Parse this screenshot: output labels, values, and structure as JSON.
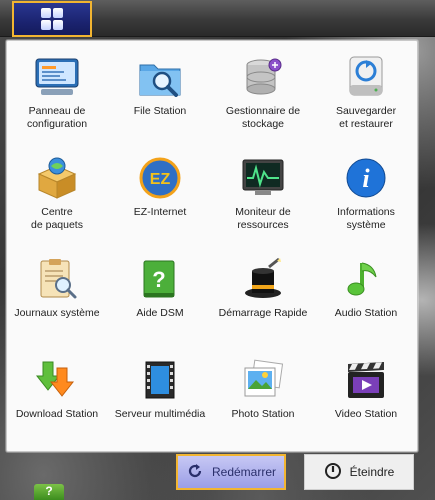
{
  "taskbar": {
    "main_menu_icon": "grid-icon"
  },
  "apps": [
    {
      "id": "control-panel",
      "label": "Panneau de\nconfiguration",
      "icon": "control-panel-icon"
    },
    {
      "id": "file-station",
      "label": "File Station",
      "icon": "file-station-icon"
    },
    {
      "id": "storage-manager",
      "label": "Gestionnaire de\nstockage",
      "icon": "storage-manager-icon"
    },
    {
      "id": "backup-restore",
      "label": "Sauvegarder\net restaurer",
      "icon": "backup-icon"
    },
    {
      "id": "package-center",
      "label": "Centre\nde paquets",
      "icon": "package-center-icon"
    },
    {
      "id": "ez-internet",
      "label": "EZ-Internet",
      "icon": "ez-internet-icon"
    },
    {
      "id": "resource-monitor",
      "label": "Moniteur de\nressources",
      "icon": "resource-monitor-icon"
    },
    {
      "id": "system-info",
      "label": "Informations\nsystème",
      "icon": "info-icon"
    },
    {
      "id": "system-logs",
      "label": "Journaux système",
      "icon": "system-logs-icon"
    },
    {
      "id": "dsm-help",
      "label": "Aide DSM",
      "icon": "help-icon"
    },
    {
      "id": "quick-start",
      "label": "Démarrage Rapide",
      "icon": "magic-hat-icon"
    },
    {
      "id": "audio-station",
      "label": "Audio Station",
      "icon": "music-note-icon"
    },
    {
      "id": "download-station",
      "label": "Download Station",
      "icon": "download-icon"
    },
    {
      "id": "media-server",
      "label": "Serveur multimédia",
      "icon": "film-strip-icon"
    },
    {
      "id": "photo-station",
      "label": "Photo Station",
      "icon": "photo-icon"
    },
    {
      "id": "video-station",
      "label": "Video Station",
      "icon": "clapperboard-icon"
    }
  ],
  "bottom": {
    "restart_label": "Redémarrer",
    "restart_icon": "restart-icon",
    "shutdown_label": "Éteindre",
    "shutdown_icon": "power-icon"
  },
  "dock_partial_icon": "help-icon",
  "dock_partial_text": "?",
  "colors": {
    "highlight_border": "#f2b531",
    "menu_button": "#1b2370",
    "restart_button": "#9b9ee6"
  }
}
